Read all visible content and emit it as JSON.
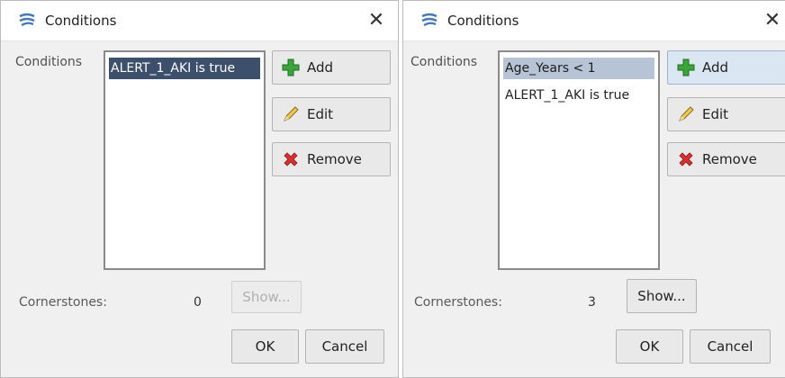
{
  "dialogs": [
    {
      "title": "Conditions",
      "conditions_label": "Conditions",
      "conditions": [
        "ALERT_1_AKI is true"
      ],
      "buttons": {
        "add": "Add",
        "edit": "Edit",
        "remove": "Remove",
        "show": "Show...",
        "ok": "OK",
        "cancel": "Cancel"
      },
      "cornerstones_label": "Cornerstones:",
      "cornerstones_count": "0"
    },
    {
      "title": "Conditions",
      "conditions_label": "Conditions",
      "conditions": [
        "Age_Years < 1",
        "ALERT_1_AKI is true"
      ],
      "buttons": {
        "add": "Add",
        "edit": "Edit",
        "remove": "Remove",
        "show": "Show...",
        "ok": "OK",
        "cancel": "Cancel"
      },
      "cornerstones_label": "Cornerstones:",
      "cornerstones_count": "3"
    }
  ],
  "icons": {
    "app": "app-logo-icon",
    "close": "close-icon",
    "add": "plus-icon",
    "edit": "pencil-icon",
    "remove": "red-x-icon"
  },
  "colors": {
    "selection_dark": "#3c4f6b",
    "selection_light": "#b7c4d6",
    "add_green": "#3aa63a",
    "remove_red": "#d83030"
  }
}
